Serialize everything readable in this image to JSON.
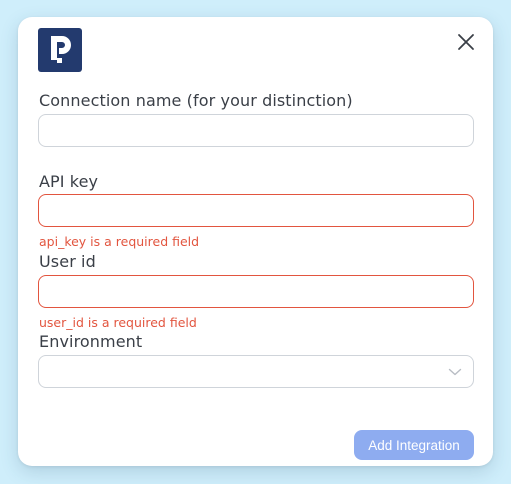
{
  "dialog": {
    "logo_icon": "parking-p-logo",
    "close_icon": "close-icon",
    "fields": {
      "connection_name": {
        "label": "Connection name (for your distinction)",
        "value": "",
        "placeholder": ""
      },
      "api_key": {
        "label": "API key",
        "value": "",
        "placeholder": "",
        "error": "api_key is a required field"
      },
      "user_id": {
        "label": "User id",
        "value": "",
        "placeholder": "",
        "error": "user_id is a required field"
      },
      "environment": {
        "label": "Environment",
        "selected": "",
        "chevron_icon": "chevron-down-icon"
      }
    },
    "submit_label": "Add Integration"
  },
  "colors": {
    "background": "#cfeefb",
    "logo_bg": "#233a6e",
    "error": "#e2553f",
    "button_bg": "#8eacf0",
    "border": "#cfd4da"
  }
}
